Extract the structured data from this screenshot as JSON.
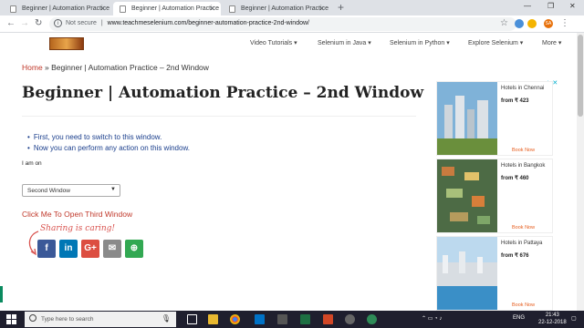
{
  "browser": {
    "tabs": [
      {
        "label": "Beginner | Automation Practice"
      },
      {
        "label": "Beginner | Automation Practice"
      },
      {
        "label": "Beginner | Automation Practice"
      }
    ],
    "security_label": "Not secure",
    "separator": "|",
    "url": "www.teachmeselenium.com/beginner-automation-practice-2nd-window/",
    "profile_initials": "SA"
  },
  "site": {
    "menu": [
      "Video Tutorials ▾",
      "Selenium in Java ▾",
      "Selenium in Python ▾",
      "Explore Selenium ▾",
      "More ▾"
    ]
  },
  "page": {
    "breadcrumb_home": "Home",
    "breadcrumb_sep": " » ",
    "breadcrumb_current": "Beginner | Automation Practice – 2nd Window",
    "title": "Beginner | Automation Practice – 2nd Window",
    "bullets": [
      "First, you need to switch to this window.",
      "Now you can perform any action on this window."
    ],
    "i_am_on_label": "I am on",
    "select_value": "Second Window",
    "third_window_link": "Click Me To Open Third Window",
    "sharing_text": "Sharing is caring!"
  },
  "share_buttons": [
    {
      "icon": "facebook-icon",
      "glyph": "f",
      "color": "#3b5998"
    },
    {
      "icon": "linkedin-icon",
      "glyph": "in",
      "color": "#0077b5"
    },
    {
      "icon": "google-plus-icon",
      "glyph": "G+",
      "color": "#dc4e41"
    },
    {
      "icon": "email-icon",
      "glyph": "✉",
      "color": "#8a8a8a"
    },
    {
      "icon": "more-share-icon",
      "glyph": "⊕",
      "color": "#32a852"
    }
  ],
  "ads": [
    {
      "city": "Hotels in Chennai",
      "price": "from ₹ 423",
      "book": "Book Now"
    },
    {
      "city": "Hotels in Bangkok",
      "price": "from ₹ 460",
      "book": "Book Now"
    },
    {
      "city": "Hotels in Pattaya",
      "price": "from ₹ 676",
      "book": "Book Now"
    }
  ],
  "taskbar": {
    "search_placeholder": "Type here to search",
    "language": "ENG",
    "time": "21:43",
    "date": "22-12-2018"
  }
}
